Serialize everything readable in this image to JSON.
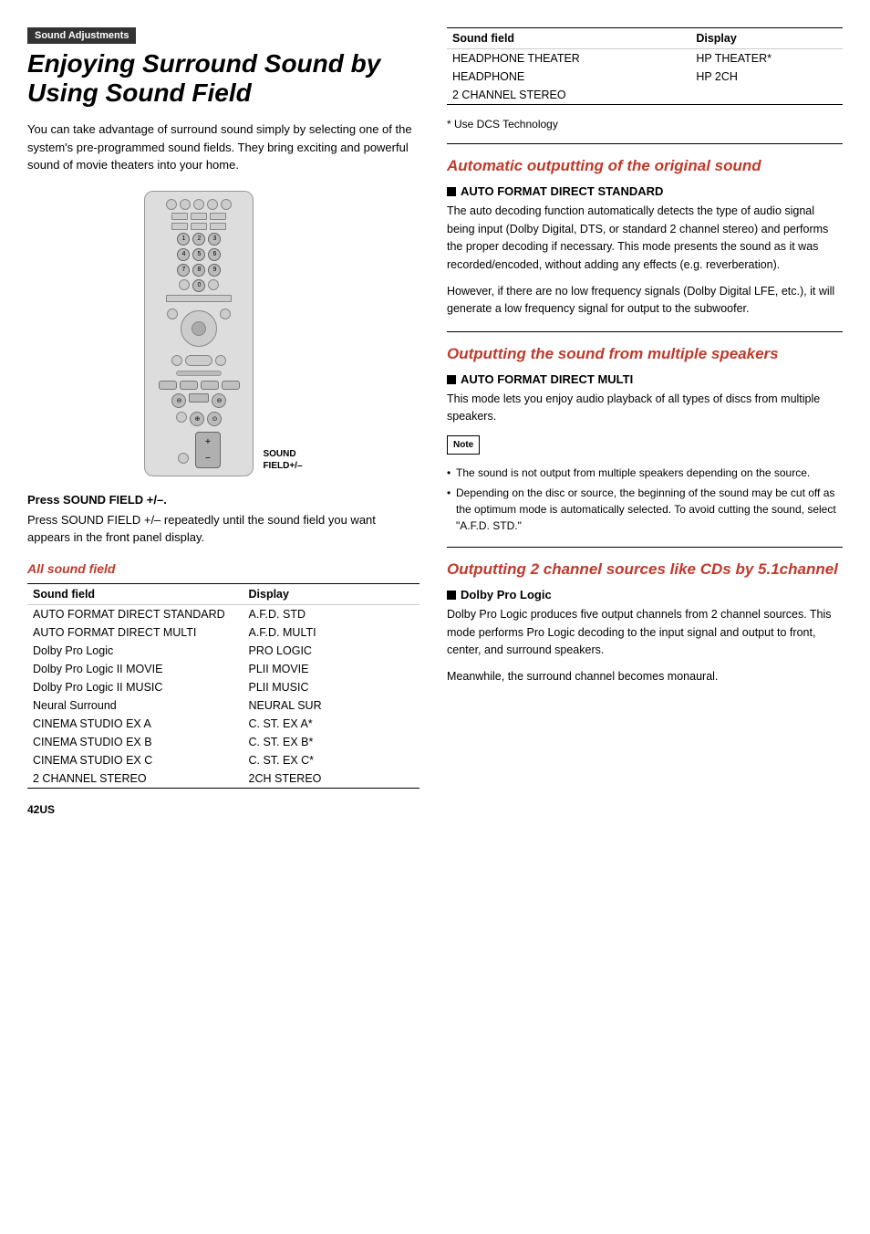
{
  "left": {
    "section_label": "Sound Adjustments",
    "main_title": "Enjoying Surround Sound by Using Sound Field",
    "intro": "You can take advantage of surround sound simply by selecting one of the system's pre-programmed sound fields. They bring exciting and powerful sound of movie theaters into your home.",
    "press_heading": "Press SOUND FIELD +/–.",
    "press_text": "Press SOUND FIELD +/– repeatedly until the sound field you want appears in the front panel display.",
    "all_sound_field": "All sound field",
    "table": {
      "col1_header": "Sound field",
      "col2_header": "Display",
      "rows": [
        [
          "AUTO FORMAT DIRECT STANDARD",
          "A.F.D. STD"
        ],
        [
          "AUTO FORMAT DIRECT MULTI",
          "A.F.D. MULTI"
        ],
        [
          "Dolby Pro Logic",
          "PRO LOGIC"
        ],
        [
          "Dolby Pro Logic II MOVIE",
          "PLII MOVIE"
        ],
        [
          "Dolby Pro Logic II MUSIC",
          "PLII MUSIC"
        ],
        [
          "Neural Surround",
          "NEURAL SUR"
        ],
        [
          "CINEMA STUDIO EX A",
          "C. ST. EX A*"
        ],
        [
          "CINEMA STUDIO EX B",
          "C. ST. EX B*"
        ],
        [
          "CINEMA STUDIO EX C",
          "C. ST. EX C*"
        ],
        [
          "2 CHANNEL STEREO",
          "2CH STEREO"
        ]
      ]
    },
    "page_number": "42US",
    "sound_field_label": "SOUND\nFIELD+/–"
  },
  "right": {
    "top_table": {
      "col1_header": "Sound field",
      "col2_header": "Display",
      "rows": [
        [
          "HEADPHONE THEATER",
          "HP THEATER*"
        ],
        [
          "HEADPHONE",
          "HP 2CH"
        ],
        [
          "2 CHANNEL STEREO",
          ""
        ]
      ]
    },
    "asterisk_note": "* Use DCS Technology",
    "section1": {
      "title": "Automatic outputting of the original sound",
      "sub": "AUTO FORMAT DIRECT STANDARD",
      "body1": "The auto decoding function automatically detects the type of audio signal being input (Dolby Digital, DTS, or standard 2 channel stereo) and performs the proper decoding if necessary. This mode presents the sound as it was recorded/encoded, without adding any effects (e.g. reverberation).",
      "body2": "However, if there are no low frequency signals (Dolby Digital LFE, etc.), it will generate a low frequency signal for output to the subwoofer."
    },
    "section2": {
      "title": "Outputting the sound from multiple speakers",
      "sub": "AUTO FORMAT DIRECT MULTI",
      "body": "This mode lets you enjoy audio playback of all types of discs from multiple speakers.",
      "note_label": "Note",
      "notes": [
        "The sound is not output from multiple speakers depending on the source.",
        "Depending on the disc or source, the beginning of the sound may be cut off as the optimum mode is automatically selected. To avoid cutting the sound, select \"A.F.D. STD.\""
      ]
    },
    "section3": {
      "title": "Outputting 2 channel sources like CDs by 5.1channel",
      "sub": "Dolby Pro Logic",
      "body1": "Dolby Pro Logic produces five output channels from 2 channel sources. This mode performs Pro Logic decoding to the input signal and output to front, center, and surround speakers.",
      "body2": "Meanwhile, the surround channel becomes monaural."
    }
  }
}
